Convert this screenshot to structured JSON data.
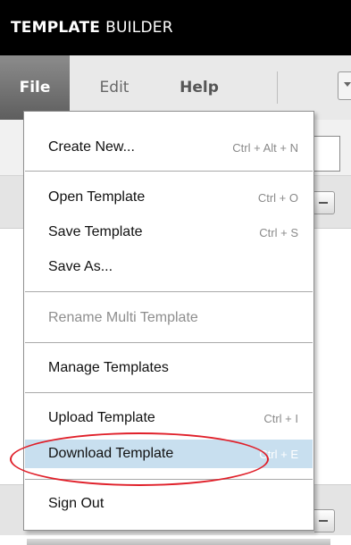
{
  "app": {
    "title_bold": "TEMPLATE",
    "title_normal": "BUILDER"
  },
  "menubar": {
    "tabs": [
      {
        "label": "File",
        "active": true
      },
      {
        "label": "Edit",
        "active": false
      },
      {
        "label": "Help",
        "active": false
      }
    ]
  },
  "file_menu": {
    "items": [
      {
        "label": "Create New...",
        "shortcut": "Ctrl + Alt + N",
        "disabled": false
      },
      {
        "label": "Open Template",
        "shortcut": "Ctrl + O",
        "disabled": false
      },
      {
        "label": "Save Template",
        "shortcut": "Ctrl + S",
        "disabled": false
      },
      {
        "label": "Save As...",
        "shortcut": "",
        "disabled": false
      },
      {
        "label": "Rename Multi Template",
        "shortcut": "",
        "disabled": true
      },
      {
        "label": "Manage Templates",
        "shortcut": "",
        "disabled": false
      },
      {
        "label": "Upload Template",
        "shortcut": "Ctrl + I",
        "disabled": false
      },
      {
        "label": "Download Template",
        "shortcut": "Ctrl + E",
        "disabled": false,
        "highlighted": true
      },
      {
        "label": "Sign Out",
        "shortcut": "",
        "disabled": false
      }
    ]
  },
  "colors": {
    "titlebar_bg": "#000000",
    "highlight_bg": "#c8dfef",
    "annotation": "#e0202a"
  }
}
